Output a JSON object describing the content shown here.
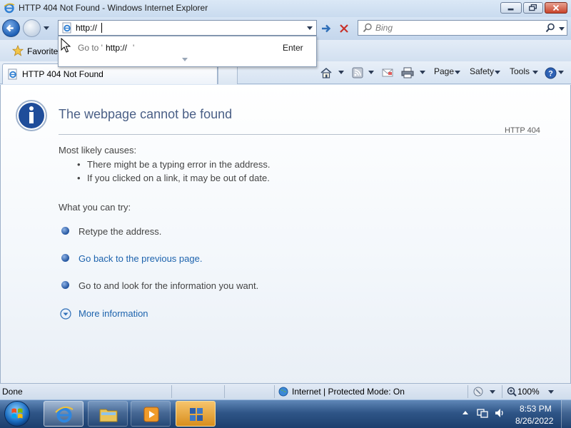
{
  "window": {
    "title": "HTTP 404 Not Found - Windows Internet Explorer"
  },
  "navigation": {
    "address_value": "http://",
    "search_placeholder": "Bing"
  },
  "autocomplete": {
    "prefix": "Go to '",
    "url": "http://",
    "suffix": "'",
    "enter_label": "Enter"
  },
  "favorites_bar": {
    "label": "Favorite"
  },
  "tab": {
    "label": "HTTP 404 Not Found"
  },
  "command_bar": {
    "page_label": "Page",
    "safety_label": "Safety",
    "tools_label": "Tools"
  },
  "content": {
    "title": "The webpage cannot be found",
    "http_code": "HTTP 404",
    "causes_heading": "Most likely causes:",
    "causes": [
      "There might be a typing error in the address.",
      "If you clicked on a link, it may be out of date."
    ],
    "try_heading": "What you can try:",
    "retype": "Retype the address.",
    "go_back": "Go back to the previous page.",
    "go_to": "Go to  and look for the information you want.",
    "more_info": "More information"
  },
  "status_bar": {
    "status": "Done",
    "zone": "Internet | Protected Mode: On",
    "zoom": "100%"
  },
  "taskbar": {
    "time": "8:53 PM",
    "date": "8/26/2022"
  },
  "colors": {
    "accent": "#1d63ad",
    "title_text": "#4a5f86"
  }
}
